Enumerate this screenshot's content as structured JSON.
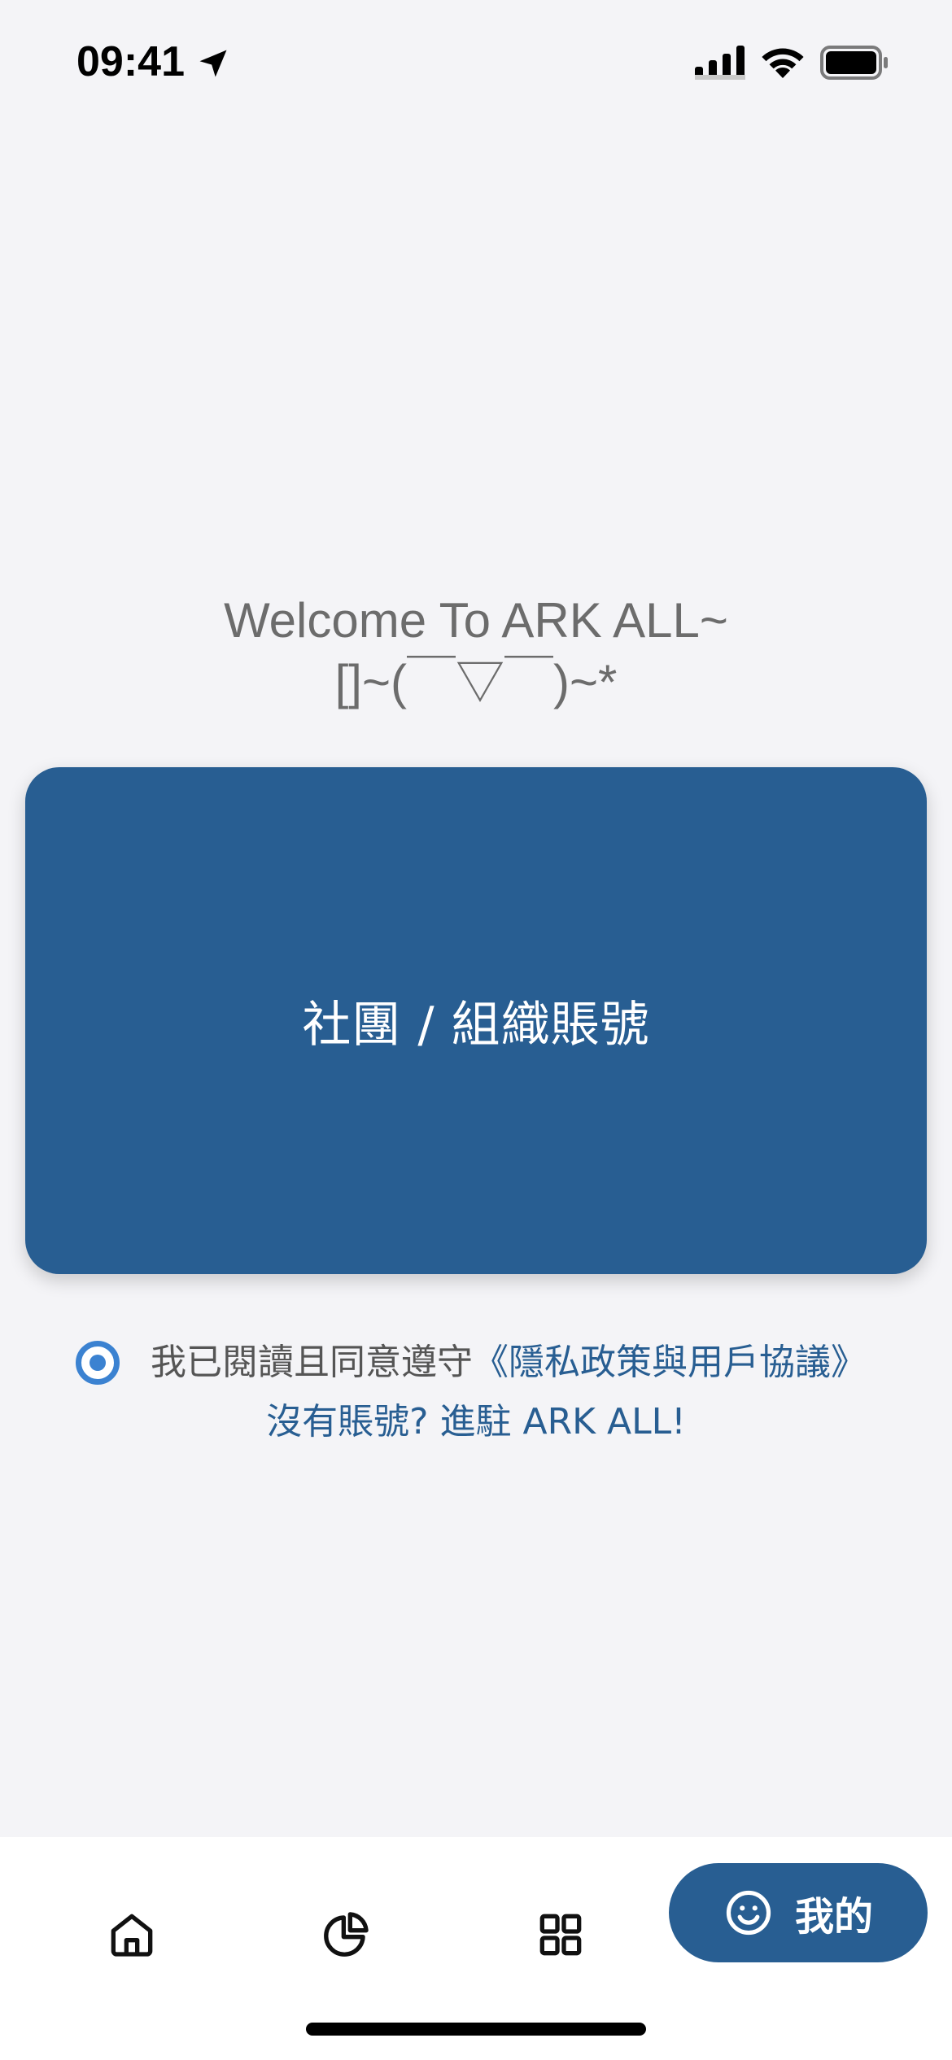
{
  "status_bar": {
    "time": "09:41",
    "icons": [
      "location-arrow-icon",
      "cellular-signal-icon",
      "wifi-icon",
      "battery-icon"
    ]
  },
  "welcome": {
    "line1": "Welcome To ARK ALL~",
    "line2": "[]~(￣▽￣)~*"
  },
  "account_card": {
    "label": "社團 / 組織賬號",
    "color": "#285e92"
  },
  "agreement": {
    "text": "我已閱讀且同意遵守",
    "link_text": "《隱私政策與用戶協議》",
    "checked": true
  },
  "signup": {
    "text": "沒有賬號? 進駐 ARK ALL!"
  },
  "tab_bar": {
    "tabs": [
      {
        "icon": "home-icon",
        "label": ""
      },
      {
        "icon": "pie-chart-icon",
        "label": ""
      },
      {
        "icon": "grid-icon",
        "label": ""
      },
      {
        "icon": "smiley-icon",
        "label": "我的",
        "active": true
      }
    ]
  },
  "colors": {
    "accent": "#285e92",
    "radio": "#3b82d1",
    "background": "#f4f4f7"
  }
}
